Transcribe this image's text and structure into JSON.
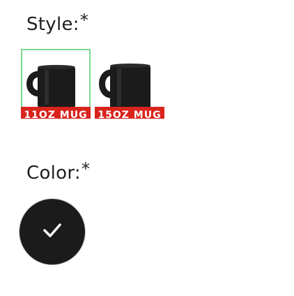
{
  "style": {
    "label": "Style:",
    "required_mark": "*",
    "options": [
      {
        "tag": "11OZ MUG",
        "selected": true,
        "icon": "black-mug-icon"
      },
      {
        "tag": "15OZ MUG",
        "selected": false,
        "icon": "black-mug-icon"
      }
    ]
  },
  "color": {
    "label": "Color:",
    "required_mark": "*",
    "swatches": [
      {
        "color": "#1b1b1b",
        "selected": true,
        "icon": "check-icon"
      }
    ]
  },
  "colors": {
    "selected_border": "#7bd88f",
    "tag_background": "#d9231d",
    "mug": "#1b1b1b"
  }
}
